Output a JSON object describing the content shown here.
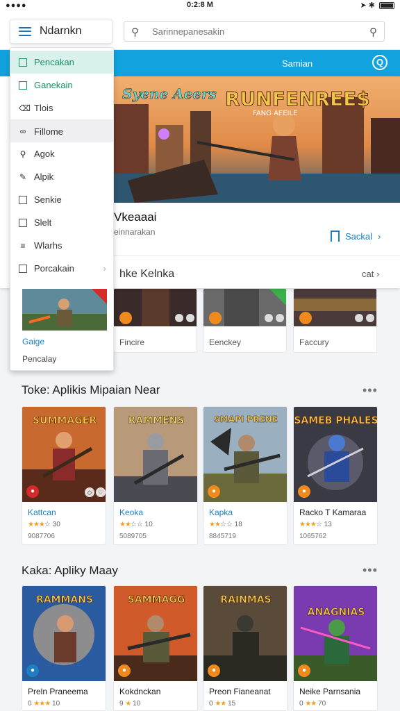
{
  "status_bar": {
    "left": "●●●●",
    "time": "0:2:8 M",
    "right": "➤ ✱"
  },
  "menu": {
    "label": "Ndarnkn"
  },
  "search": {
    "placeholder": "Sarinnepanesakin"
  },
  "band": {
    "label": "Samian"
  },
  "feature": {
    "banner_title": "RUNFENREE$",
    "banner_sub": "FANG AEEILE",
    "banner_logo": "Syene Aeers",
    "title": "Vkeaaai",
    "subtitle": "einnarakan",
    "save_label": "Sackal",
    "row_label": "hke Kelnka",
    "row_cat": "cat"
  },
  "dropdown": {
    "items": [
      {
        "label": "Pencakan"
      },
      {
        "label": "Ganekain"
      },
      {
        "label": "Tlois"
      },
      {
        "label": "Fillome"
      },
      {
        "label": "Agok"
      },
      {
        "label": "Alpik"
      },
      {
        "label": "Senkie"
      },
      {
        "label": "Slelt"
      },
      {
        "label": "Wlarhs"
      },
      {
        "label": "Porcakain"
      }
    ],
    "sub1": "Gaige",
    "sub2": "Pencalay"
  },
  "partial_row": {
    "labels": [
      "Fincire",
      "Eenckey",
      "Faccury"
    ]
  },
  "section1": {
    "title": "Toke: Aplikis Mipaian Near",
    "more": "•••",
    "cards": [
      {
        "name": "Kattcan",
        "rating": "30",
        "count": "9087706",
        "art": "SUMMAGER"
      },
      {
        "name": "Keoka",
        "rating": "10",
        "count": "5089705",
        "art": "RAMMENS"
      },
      {
        "name": "Kapka",
        "rating": "18",
        "count": "8845719",
        "art": "SMAPI PRENE"
      },
      {
        "name": "Racko T Kamaraa",
        "rating": "13",
        "count": "1065762",
        "art": "SAMEB PHALES"
      }
    ]
  },
  "section2": {
    "title": "Kaka: Apliky Maay",
    "more": "•••",
    "cards": [
      {
        "name": "Preln Praneema",
        "rating": "10",
        "count": "0",
        "art": "RAMMANS"
      },
      {
        "name": "Kokdnckan",
        "rating": "10",
        "count": "9",
        "art": "SAMMAGG"
      },
      {
        "name": "Preon Fianeanat",
        "rating": "15",
        "count": "0",
        "art": "RAINMAS"
      },
      {
        "name": "Neike Parnsania",
        "rating": "70",
        "count": "0",
        "art": "ANAGNIAS"
      }
    ]
  },
  "colors": {
    "accent": "#12a3df",
    "link": "#1d7fc1",
    "green": "#19905f",
    "orange": "#f08a1c"
  }
}
